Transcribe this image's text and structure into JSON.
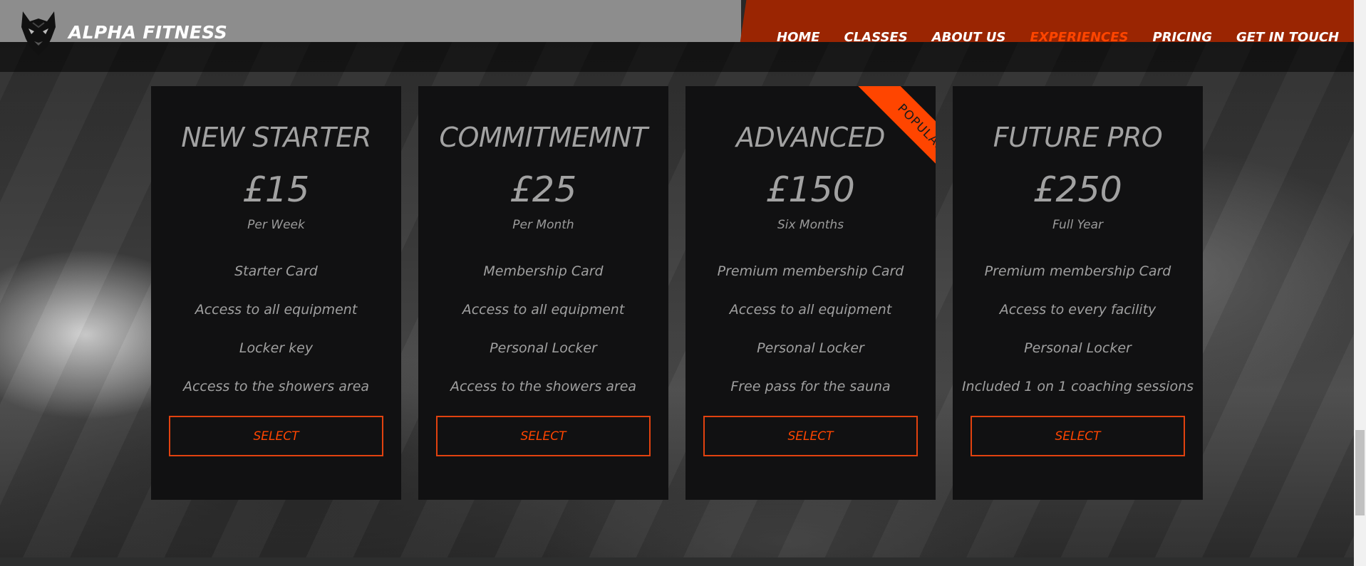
{
  "brand": {
    "name": "ALPHA FITNESS",
    "logo_icon": "wolf-icon"
  },
  "nav": {
    "items": [
      {
        "label": "HOME"
      },
      {
        "label": "CLASSES"
      },
      {
        "label": "ABOUT US"
      },
      {
        "label": "EXPERIENCES"
      },
      {
        "label": "PRICING"
      },
      {
        "label": "GET IN TOUCH"
      }
    ],
    "active": "EXPERIENCES"
  },
  "plans": [
    {
      "title": "NEW STARTER",
      "price": "£15",
      "period": "Per Week",
      "features": [
        "Starter Card",
        "Access to all equipment",
        "Locker key",
        "Access to the showers area"
      ],
      "button": "SELECT"
    },
    {
      "title": "COMMITMEMNT",
      "price": "£25",
      "period": "Per Month",
      "features": [
        "Membership Card",
        "Access to all equipment",
        "Personal Locker",
        "Access to the showers area"
      ],
      "button": "SELECT"
    },
    {
      "title": "ADVANCED",
      "price": "£150",
      "period": "Six Months",
      "features": [
        "Premium membership Card",
        "Access to all equipment",
        "Personal Locker",
        "Free pass for the sauna"
      ],
      "button": "SELECT",
      "badge": "POPULAR"
    },
    {
      "title": "FUTURE PRO",
      "price": "£250",
      "period": "Full Year",
      "features": [
        "Premium membership Card",
        "Access to every facility",
        "Personal Locker",
        "Included 1 on 1 coaching sessions"
      ],
      "button": "SELECT"
    }
  ],
  "colors": {
    "accent": "#ff4500",
    "header_left": "#8d8d8d",
    "header_right": "#9a2502",
    "card_bg": "#111112"
  }
}
